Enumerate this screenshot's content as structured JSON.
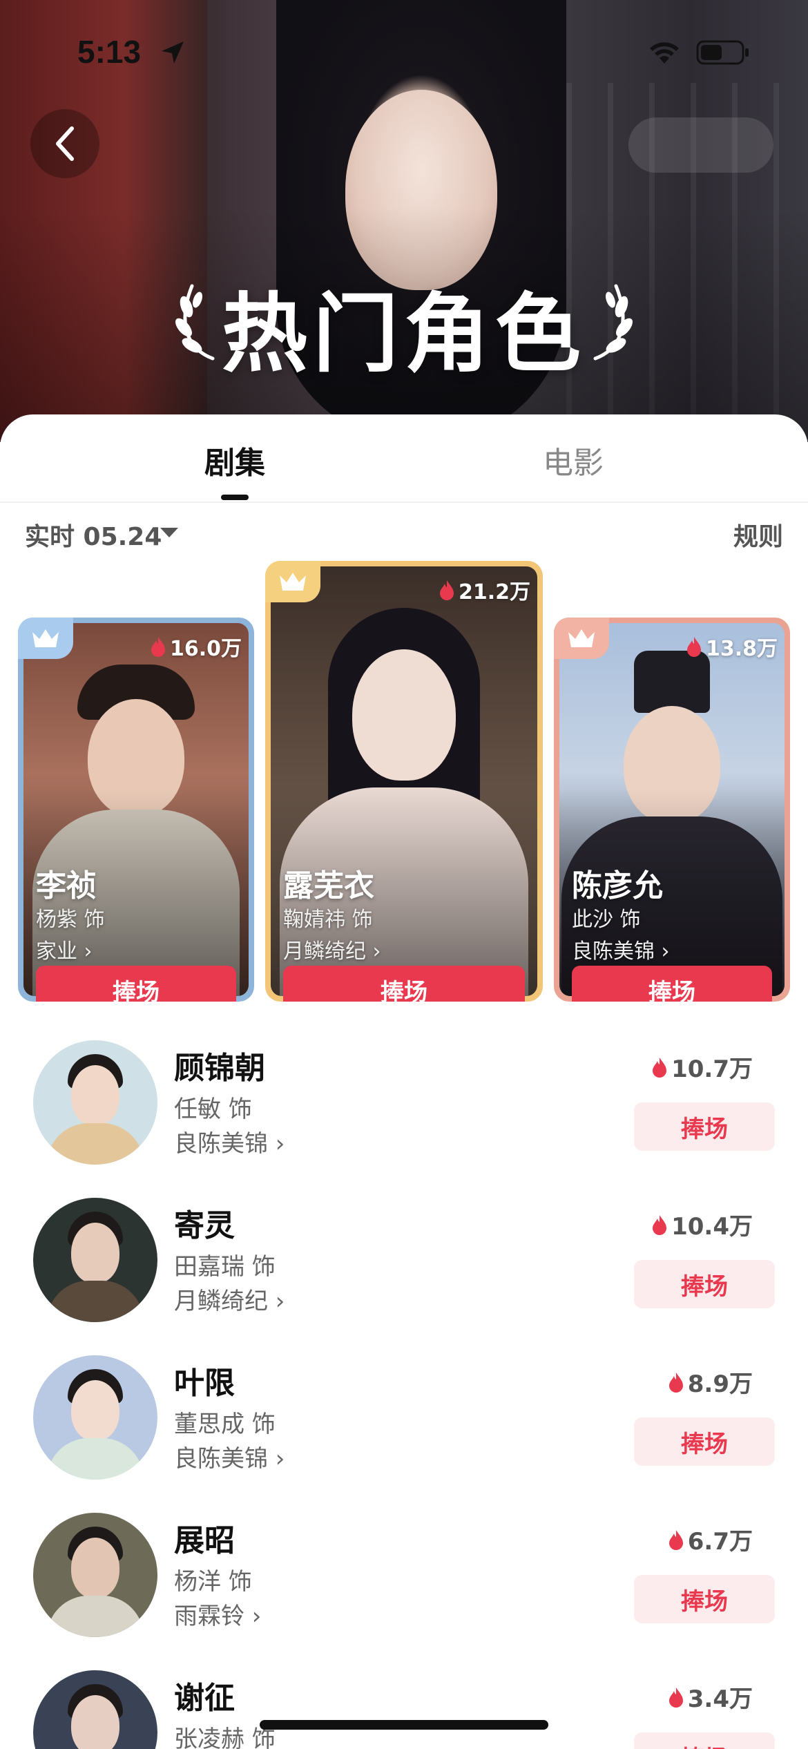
{
  "status_bar": {
    "time": "5:13"
  },
  "hero": {
    "title": "热门角色"
  },
  "tabs": [
    {
      "label": "剧集",
      "active": true
    },
    {
      "label": "电影",
      "active": false
    }
  ],
  "filter": {
    "label": "实时 05.24",
    "rules": "规则"
  },
  "podium": [
    {
      "rank": 2,
      "heat": "16.0万",
      "name": "李祯",
      "actor": "杨紫 饰",
      "show": "家业",
      "button": "捧场",
      "frame_color": "#8fb4da"
    },
    {
      "rank": 1,
      "heat": "21.2万",
      "name": "露芜衣",
      "actor": "鞠婧祎 饰",
      "show": "月鳞绮纪",
      "button": "捧场",
      "frame_color": "#f2c676"
    },
    {
      "rank": 3,
      "heat": "13.8万",
      "name": "陈彦允",
      "actor": "此沙 饰",
      "show": "良陈美锦",
      "button": "捧场",
      "frame_color": "#eaa293"
    }
  ],
  "list": [
    {
      "name": "顾锦朝",
      "actor": "任敏 饰",
      "show": "良陈美锦",
      "heat": "10.7万",
      "button": "捧场"
    },
    {
      "name": "寄灵",
      "actor": "田嘉瑞 饰",
      "show": "月鳞绮纪",
      "heat": "10.4万",
      "button": "捧场"
    },
    {
      "name": "叶限",
      "actor": "董思成 饰",
      "show": "良陈美锦",
      "heat": "8.9万",
      "button": "捧场"
    },
    {
      "name": "展昭",
      "actor": "杨洋 饰",
      "show": "雨霖铃",
      "heat": "6.7万",
      "button": "捧场"
    },
    {
      "name": "谢征",
      "actor": "张凌赫 饰",
      "show": "",
      "heat": "3.4万",
      "button": "捧场"
    }
  ],
  "colors": {
    "accent": "#e8394f",
    "accent_light": "#fdecee"
  }
}
